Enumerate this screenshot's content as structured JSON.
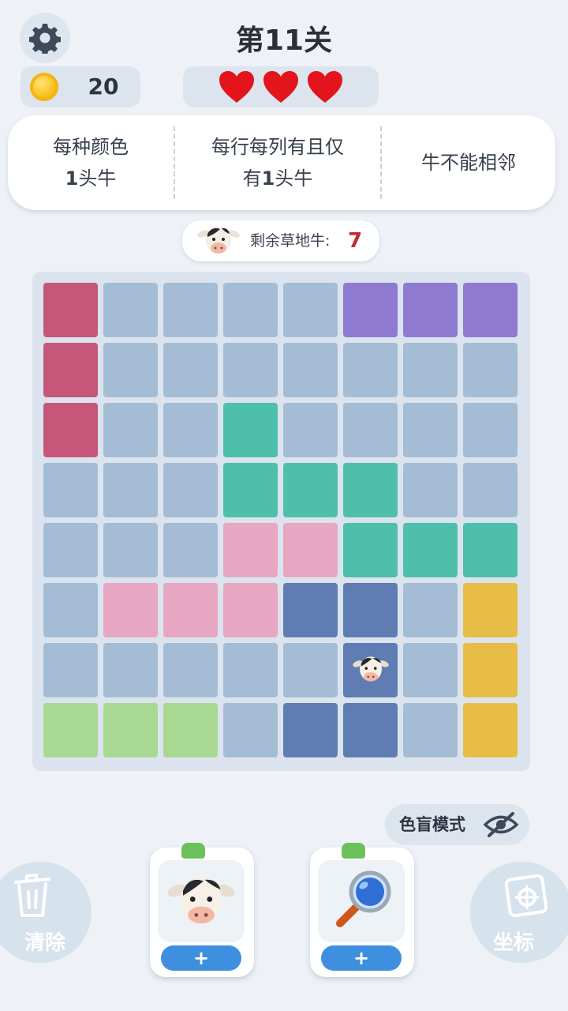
{
  "header": {
    "level_title": "第11关",
    "coins": "20",
    "lives": 3,
    "settings_icon": "gear-icon"
  },
  "rules": {
    "rule1_line1": "每种颜色",
    "rule1_line2_num": "1",
    "rule1_line2_text": "头牛",
    "rule2_line1": "每行每列有且仅",
    "rule2_line2_pre": "有",
    "rule2_line2_num": "1",
    "rule2_line2_text": "头牛",
    "rule3": "牛不能相邻"
  },
  "remaining": {
    "label": "剩余草地牛:",
    "value": "7"
  },
  "board": {
    "size": 8,
    "grid": [
      [
        "C",
        "G",
        "G",
        "G",
        "G",
        "P",
        "P",
        "P"
      ],
      [
        "C",
        "G",
        "G",
        "G",
        "G",
        "G",
        "G",
        "G"
      ],
      [
        "C",
        "G",
        "G",
        "T",
        "G",
        "G",
        "G",
        "G"
      ],
      [
        "G",
        "G",
        "G",
        "T",
        "T",
        "T",
        "G",
        "G"
      ],
      [
        "G",
        "G",
        "G",
        "K",
        "K",
        "T",
        "T",
        "T"
      ],
      [
        "G",
        "K",
        "K",
        "K",
        "B",
        "B",
        "G",
        "Y"
      ],
      [
        "G",
        "G",
        "G",
        "G",
        "G",
        "B",
        "G",
        "Y"
      ],
      [
        "L",
        "L",
        "L",
        "G",
        "B",
        "B",
        "G",
        "Y"
      ]
    ],
    "cows": [
      [
        6,
        5
      ]
    ],
    "colors": {
      "G": "#a5bcd5",
      "C": "#c7567b",
      "P": "#8e7ad0",
      "T": "#4ebfab",
      "K": "#e7a6c2",
      "B": "#5f7db2",
      "Y": "#e7bd45",
      "L": "#a9d893"
    }
  },
  "colorblind": {
    "label": "色盲模式",
    "icon": "eye-off-icon"
  },
  "bottom": {
    "clear_label": "清除",
    "coord_label": "坐标",
    "tool1_icon": "cow-icon",
    "tool2_icon": "magnifier-icon",
    "plus": "+"
  }
}
